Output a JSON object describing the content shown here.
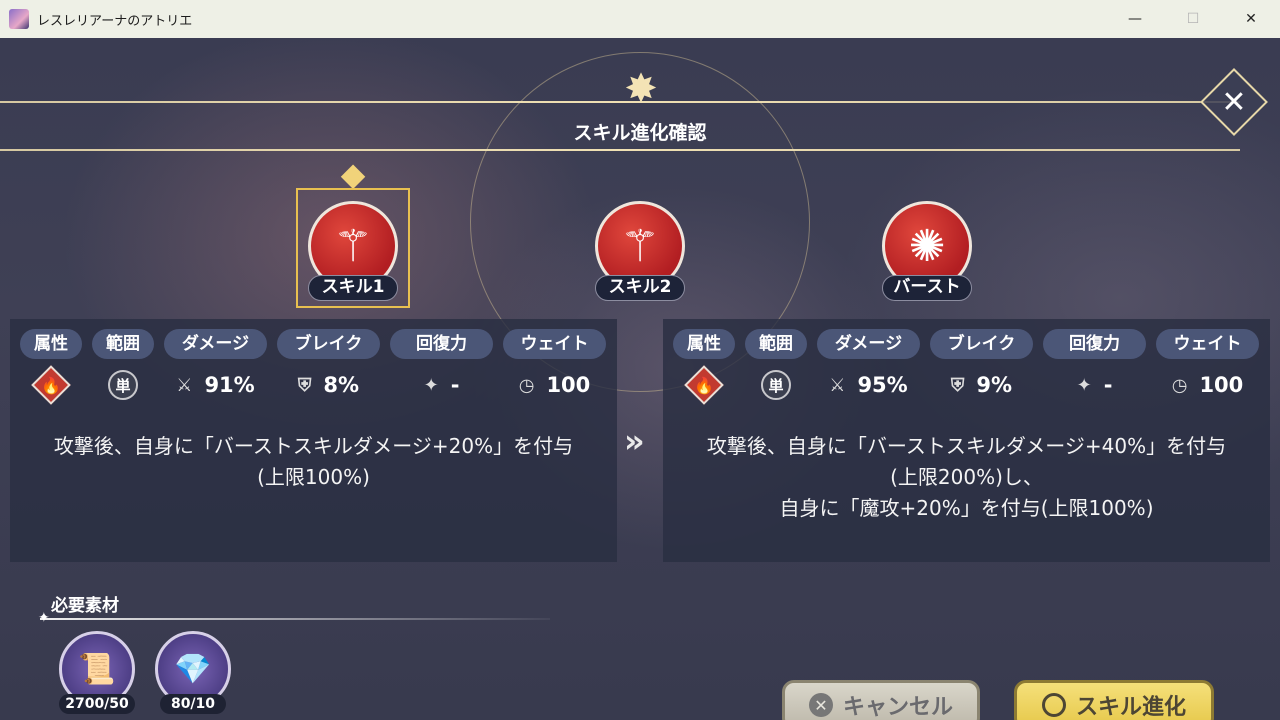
{
  "window": {
    "title": "レスレリアーナのアトリエ",
    "minimize": "—",
    "maximize": "☐",
    "close": "✕"
  },
  "header": {
    "title": "スキル進化確認",
    "close_icon": "✕"
  },
  "skills": [
    {
      "label": "スキル1",
      "selected": true
    },
    {
      "label": "スキル2",
      "selected": false
    },
    {
      "label": "バースト",
      "selected": false
    }
  ],
  "stat_headers": [
    "属性",
    "範囲",
    "ダメージ",
    "ブレイク",
    "回復力",
    "ウェイト"
  ],
  "before": {
    "range": "単",
    "damage": "91%",
    "break": "8%",
    "heal": "-",
    "wait": "100",
    "description_lines": [
      "攻撃後、自身に「バーストスキルダメージ+20%」を付与",
      "(上限100%)"
    ]
  },
  "after": {
    "range": "単",
    "damage": "95%",
    "break": "9%",
    "heal": "-",
    "wait": "100",
    "description_lines": [
      "攻撃後、自身に「バーストスキルダメージ+40%」を付与",
      "(上限200%)し、",
      "自身に「魔攻+20%」を付与(上限100%)"
    ]
  },
  "arrow": "»",
  "materials": {
    "title": "必要素材",
    "items": [
      {
        "icon": "scroll-icon",
        "count": "2700/50"
      },
      {
        "icon": "crystal-icon",
        "count": "80/10"
      }
    ]
  },
  "buttons": {
    "cancel": "キャンセル",
    "evolve": "スキル進化"
  },
  "colors": {
    "fire": "#c23a30",
    "chip": "#4b5677",
    "evolve_button": "#f0d664"
  }
}
